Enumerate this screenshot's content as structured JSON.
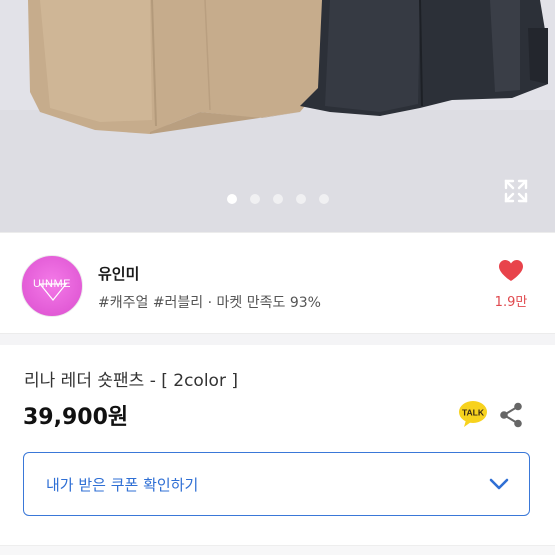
{
  "gallery": {
    "slide_count": 5,
    "active_index": 0,
    "expand_icon": "expand-icon"
  },
  "shop": {
    "avatar_text": "UINME",
    "name": "유인미",
    "tags": "#캐주얼 #러블리 · 마켓 만족도 93%",
    "likes": "1.9만",
    "heart_icon": "heart-icon",
    "heart_color": "#e8434b",
    "avatar_color": "#e25bd6"
  },
  "product": {
    "title": "리나 레더 숏팬츠 - [ 2color ]",
    "price": "39,900원",
    "talk_label": "TALK",
    "talk_color": "#f7d21e",
    "share_icon": "share-icon"
  },
  "coupon": {
    "label": "내가 받은 쿠폰 확인하기",
    "accent": "#3a78d8",
    "chevron_icon": "chevron-down-icon"
  }
}
